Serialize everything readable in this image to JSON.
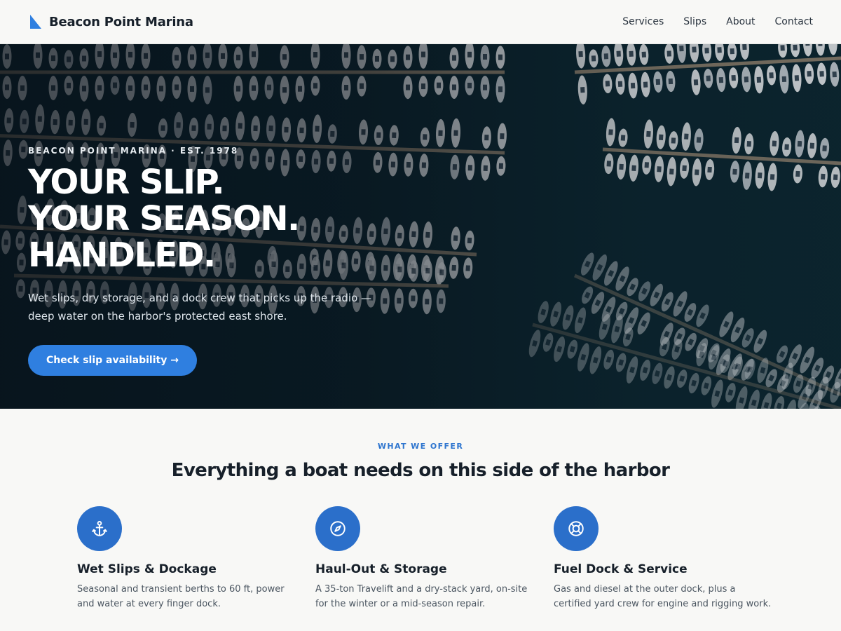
{
  "header": {
    "brand_name": "Beacon Point Marina",
    "nav": [
      "Services",
      "Slips",
      "About",
      "Contact"
    ]
  },
  "hero": {
    "eyebrow": "BEACON POINT MARINA · EST. 1978",
    "title_lines": [
      "YOUR SLIP.",
      "YOUR SEASON.",
      "HANDLED."
    ],
    "description_lines": [
      "Wet slips, dry storage, and a dock crew that picks up the radio —",
      "deep water on the harbor's protected east shore."
    ],
    "cta_label": "Check slip availability →"
  },
  "services": {
    "eyebrow": "WHAT WE OFFER",
    "title": "Everything a boat needs on this side of the harbor",
    "items": [
      {
        "icon": "anchor-icon",
        "title": "Wet Slips & Dockage",
        "description_lines": [
          "Seasonal and transient berths to 60 ft, power",
          "and water at every finger dock."
        ]
      },
      {
        "icon": "compass-icon",
        "title": "Haul-Out & Storage",
        "description_lines": [
          "A 35-ton Travelift and a dry-stack yard, on-site",
          "for the winter or a mid-season repair."
        ]
      },
      {
        "icon": "lifebuoy-icon",
        "title": "Fuel Dock & Service",
        "description_lines": [
          "Gas and diesel at the outer dock, plus a",
          "certified yard crew for engine and rigging work."
        ]
      }
    ]
  },
  "colors": {
    "accent": "#2f7fe0",
    "icon_circle": "#2b6fca",
    "eyebrow_blue": "#2f76cf",
    "page_background": "#f8f8f6",
    "water": "#0b1f28"
  }
}
